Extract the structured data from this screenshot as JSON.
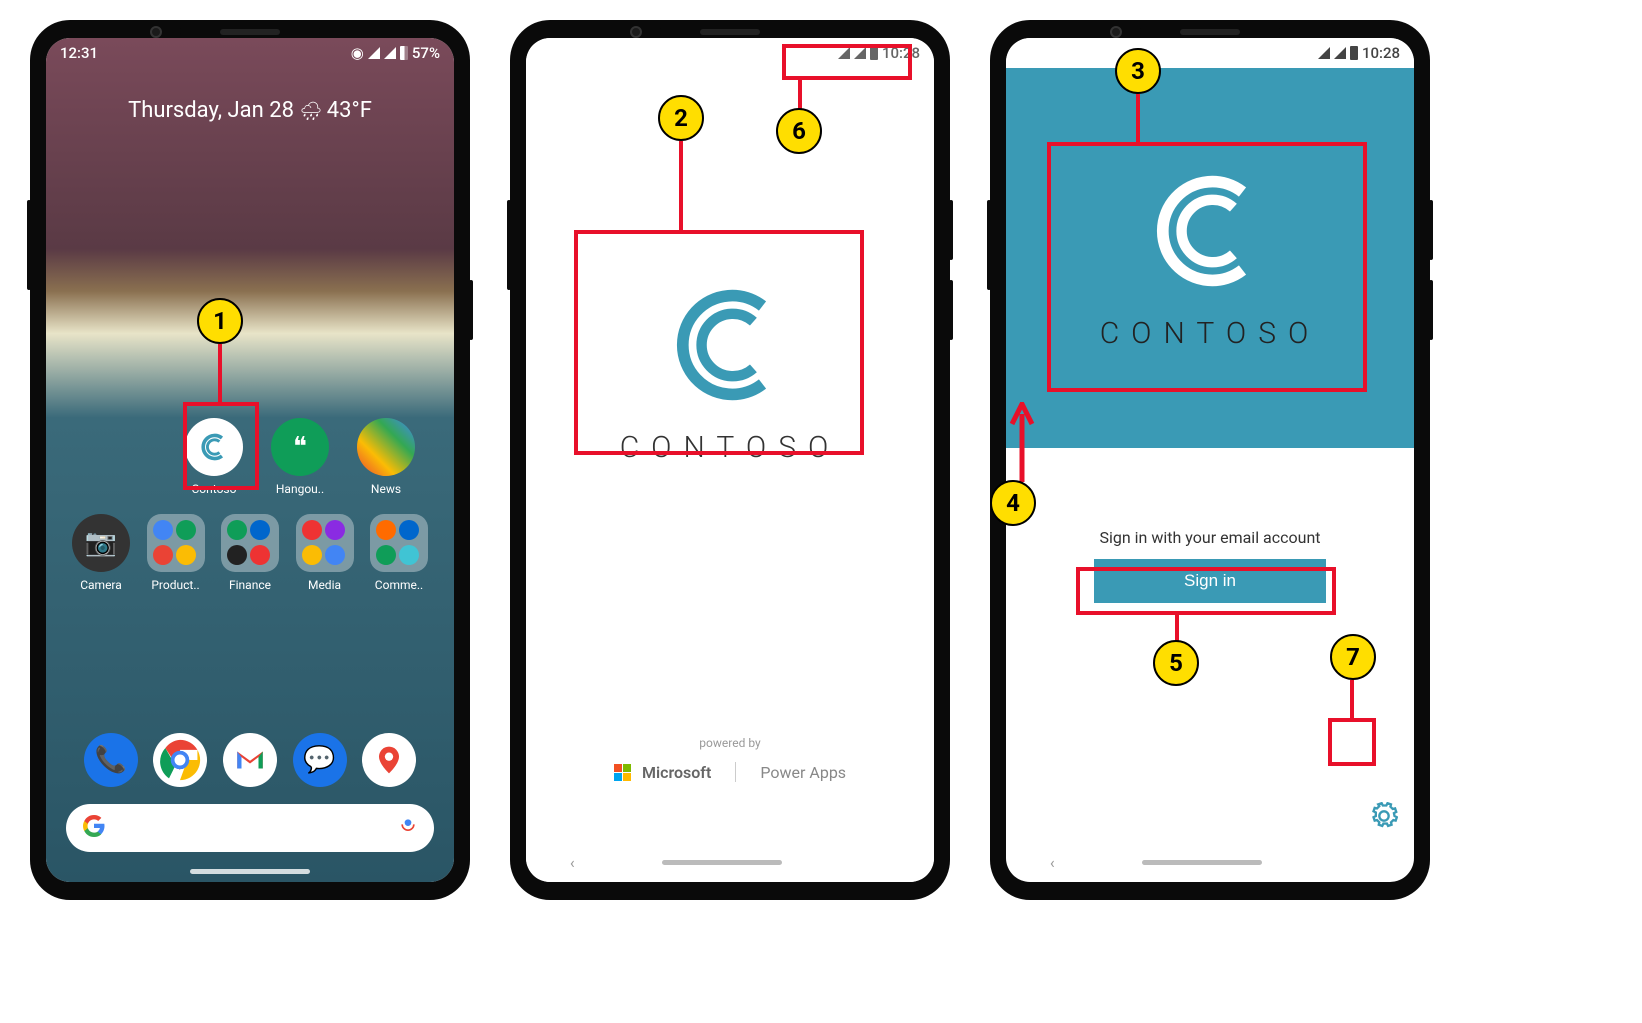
{
  "phone1": {
    "status": {
      "time": "12:31",
      "battery_pct": "57%"
    },
    "date_line": "Thursday, Jan 28",
    "temp": "43°F",
    "apps_row1": [
      {
        "name": "Contoso",
        "label": "Contoso",
        "icon": "contoso"
      },
      {
        "name": "Hangouts",
        "label": "Hangou..",
        "icon": "hangouts"
      },
      {
        "name": "News",
        "label": "News",
        "icon": "news"
      }
    ],
    "apps_row2": [
      {
        "name": "Camera",
        "label": "Camera",
        "icon": "camera"
      },
      {
        "name": "Productivity",
        "label": "Product..",
        "icon": "folder"
      },
      {
        "name": "Finance",
        "label": "Finance",
        "icon": "folder"
      },
      {
        "name": "Media",
        "label": "Media",
        "icon": "folder"
      },
      {
        "name": "Commerce",
        "label": "Comme..",
        "icon": "folder"
      }
    ],
    "dock": [
      "phone",
      "chrome",
      "gmail",
      "messages",
      "maps"
    ]
  },
  "phone2": {
    "status_time": "10:28",
    "brand": "CONTOSO",
    "powered_by": "powered by",
    "microsoft": "Microsoft",
    "powerapps": "Power Apps"
  },
  "phone3": {
    "status_time": "10:28",
    "brand": "CONTOSO",
    "signin_prompt": "Sign in with your email account",
    "signin_button": "Sign in"
  },
  "annotations": {
    "1": "1",
    "2": "2",
    "3": "3",
    "4": "4",
    "5": "5",
    "6": "6",
    "7": "7"
  },
  "colors": {
    "accent": "#3a9ab5",
    "callout_red": "#e8102a",
    "badge": "#ffde00"
  }
}
